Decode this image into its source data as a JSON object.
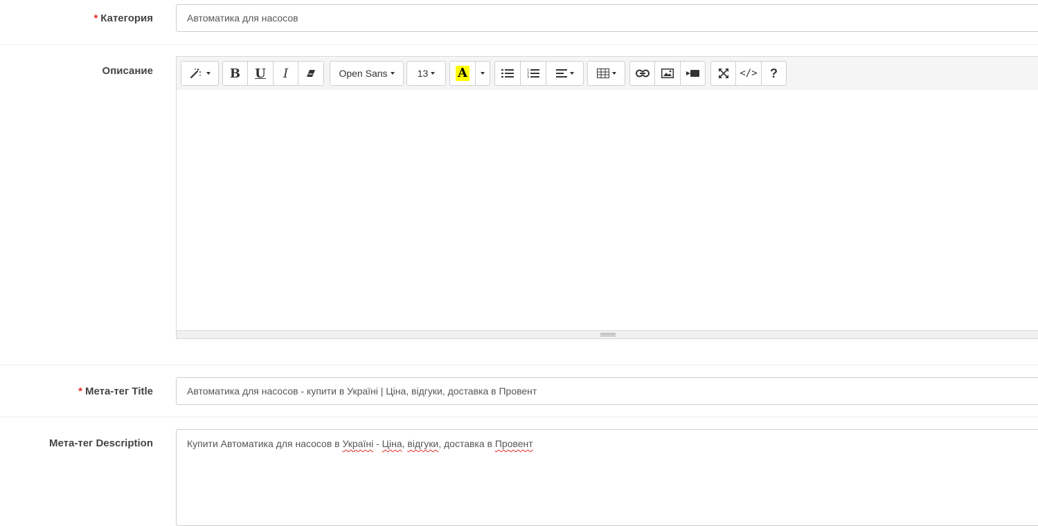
{
  "form": {
    "category": {
      "required_marker": "*",
      "label": "Категория",
      "value": "Автоматика для насосов"
    },
    "description": {
      "label": "Описание",
      "editor": {
        "toolbar": {
          "style_icon": "magic-wand-icon",
          "bold_label": "B",
          "underline_label": "U",
          "italic_label": "I",
          "clear_format_icon": "eraser-icon",
          "font_family": "Open Sans",
          "font_size": "13",
          "color_label": "A",
          "highlight_color": "#ffff00",
          "unordered_list_icon": "list-ul-icon",
          "ordered_list_icon": "list-ol-icon",
          "align_icon": "align-left-icon",
          "table_icon": "table-icon",
          "link_icon": "link-icon",
          "picture_icon": "picture-icon",
          "video_icon": "video-icon",
          "fullscreen_icon": "fullscreen-icon",
          "codeview_label": "</>",
          "help_label": "?"
        },
        "content": ""
      }
    },
    "meta_title": {
      "required_marker": "*",
      "label": "Мета-тег Title",
      "value": "Автоматика для насосов - купити в Україні | Ціна, відгуки, доставка в Провент"
    },
    "meta_description": {
      "label": "Мета-тег Description",
      "value_parts": {
        "p1": "Купити Автоматика для насосов в ",
        "p2": "Україні",
        "p3": " - ",
        "p4": "Ціна",
        "p5": ", ",
        "p6": "відгуки",
        "p7": ", доставка в ",
        "p8": "Провент"
      }
    }
  },
  "colors": {
    "required": "#e3281f",
    "label": "#444444",
    "text": "#555555",
    "border": "#cccccc",
    "toolbar_bg": "#f5f5f5"
  }
}
